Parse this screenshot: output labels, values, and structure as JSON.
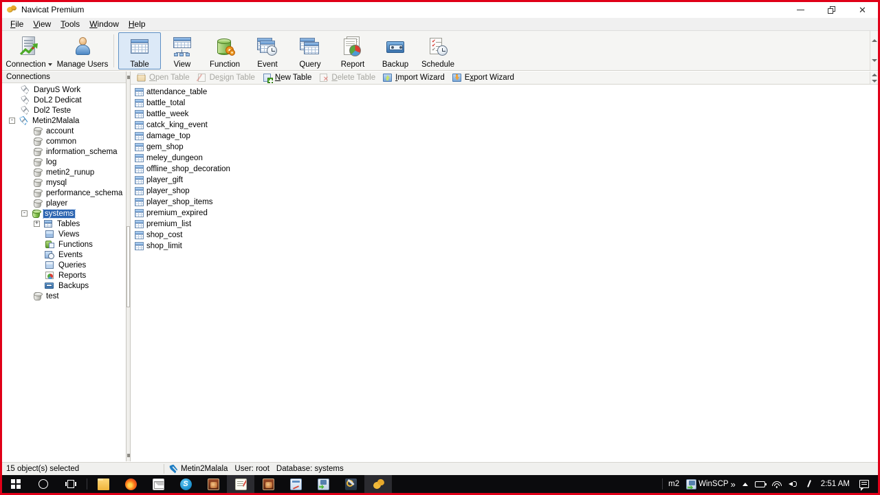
{
  "window": {
    "title": "Navicat Premium",
    "icon": "navicat-paw-icon",
    "controls": {
      "minimize": "minimize",
      "restore": "restore",
      "close": "close"
    }
  },
  "menubar": {
    "items": [
      {
        "label": "File",
        "accel": "F"
      },
      {
        "label": "View",
        "accel": "V"
      },
      {
        "label": "Tools",
        "accel": "T"
      },
      {
        "label": "Window",
        "accel": "W"
      },
      {
        "label": "Help",
        "accel": "H"
      }
    ]
  },
  "toolbar": {
    "connection": {
      "label": "Connection",
      "icon": "connection-icon",
      "has_dropdown": true
    },
    "manage_users": {
      "label": "Manage Users",
      "icon": "manage-users-icon"
    },
    "objects": [
      {
        "label": "Table",
        "icon": "table-icon",
        "selected": true
      },
      {
        "label": "View",
        "icon": "view-icon",
        "selected": false
      },
      {
        "label": "Function",
        "icon": "function-icon",
        "selected": false
      },
      {
        "label": "Event",
        "icon": "event-icon",
        "selected": false
      },
      {
        "label": "Query",
        "icon": "query-icon",
        "selected": false
      },
      {
        "label": "Report",
        "icon": "report-icon",
        "selected": false
      },
      {
        "label": "Backup",
        "icon": "backup-icon",
        "selected": false
      },
      {
        "label": "Schedule",
        "icon": "schedule-icon",
        "selected": false
      }
    ]
  },
  "content_toolbar": {
    "buttons": [
      {
        "label": "Open Table",
        "accel": "O",
        "icon": "open-table-icon",
        "disabled": true
      },
      {
        "label": "Design Table",
        "accel": "s",
        "icon": "design-table-icon",
        "disabled": true
      },
      {
        "label": "New Table",
        "accel": "N",
        "icon": "new-table-icon",
        "disabled": false
      },
      {
        "label": "Delete Table",
        "accel": "D",
        "icon": "delete-table-icon",
        "disabled": true
      },
      {
        "label": "Import Wizard",
        "accel": "I",
        "icon": "import-wizard-icon",
        "disabled": false
      },
      {
        "label": "Export Wizard",
        "accel": "x",
        "icon": "export-wizard-icon",
        "disabled": false
      }
    ]
  },
  "sidebar": {
    "header": "Connections",
    "nodes": [
      {
        "label": "DaryuS Work",
        "icon": "connection-icon",
        "depth": 0,
        "expander": "",
        "connected": false
      },
      {
        "label": "DoL2 Dedicat",
        "icon": "connection-icon",
        "depth": 0,
        "expander": "",
        "connected": false
      },
      {
        "label": "Dol2 Teste",
        "icon": "connection-icon",
        "depth": 0,
        "expander": "",
        "connected": false
      },
      {
        "label": "Metin2Malala",
        "icon": "connection-icon",
        "depth": 0,
        "expander": "-",
        "connected": true
      },
      {
        "label": "account",
        "icon": "database-icon",
        "depth": 1,
        "expander": "",
        "open": false
      },
      {
        "label": "common",
        "icon": "database-icon",
        "depth": 1,
        "expander": "",
        "open": false
      },
      {
        "label": "information_schema",
        "icon": "database-icon",
        "depth": 1,
        "expander": "",
        "open": false
      },
      {
        "label": "log",
        "icon": "database-icon",
        "depth": 1,
        "expander": "",
        "open": false
      },
      {
        "label": "metin2_runup",
        "icon": "database-icon",
        "depth": 1,
        "expander": "",
        "open": false
      },
      {
        "label": "mysql",
        "icon": "database-icon",
        "depth": 1,
        "expander": "",
        "open": false
      },
      {
        "label": "performance_schema",
        "icon": "database-icon",
        "depth": 1,
        "expander": "",
        "open": false
      },
      {
        "label": "player",
        "icon": "database-icon",
        "depth": 1,
        "expander": "",
        "open": false
      },
      {
        "label": "systems",
        "icon": "database-open-icon",
        "depth": 1,
        "expander": "-",
        "open": true,
        "selected": true
      },
      {
        "label": "Tables",
        "icon": "tables-folder-icon",
        "depth": 2,
        "expander": "+"
      },
      {
        "label": "Views",
        "icon": "views-folder-icon",
        "depth": 2,
        "expander": ""
      },
      {
        "label": "Functions",
        "icon": "functions-folder-icon",
        "depth": 2,
        "expander": ""
      },
      {
        "label": "Events",
        "icon": "events-folder-icon",
        "depth": 2,
        "expander": ""
      },
      {
        "label": "Queries",
        "icon": "queries-folder-icon",
        "depth": 2,
        "expander": ""
      },
      {
        "label": "Reports",
        "icon": "reports-folder-icon",
        "depth": 2,
        "expander": ""
      },
      {
        "label": "Backups",
        "icon": "backups-folder-icon",
        "depth": 2,
        "expander": ""
      },
      {
        "label": "test",
        "icon": "database-icon",
        "depth": 1,
        "expander": "",
        "open": false
      }
    ]
  },
  "object_list": {
    "items": [
      {
        "name": "attendance_table",
        "icon": "table-item-icon"
      },
      {
        "name": "battle_total",
        "icon": "table-item-icon"
      },
      {
        "name": "battle_week",
        "icon": "table-item-icon"
      },
      {
        "name": "catck_king_event",
        "icon": "table-item-icon"
      },
      {
        "name": "damage_top",
        "icon": "table-item-icon"
      },
      {
        "name": "gem_shop",
        "icon": "table-item-icon"
      },
      {
        "name": "meley_dungeon",
        "icon": "table-item-icon"
      },
      {
        "name": "offline_shop_decoration",
        "icon": "table-item-icon"
      },
      {
        "name": "player_gift",
        "icon": "table-item-icon"
      },
      {
        "name": "player_shop",
        "icon": "table-item-icon"
      },
      {
        "name": "player_shop_items",
        "icon": "table-item-icon"
      },
      {
        "name": "premium_expired",
        "icon": "table-item-icon"
      },
      {
        "name": "premium_list",
        "icon": "table-item-icon"
      },
      {
        "name": "shop_cost",
        "icon": "table-item-icon"
      },
      {
        "name": "shop_limit",
        "icon": "table-item-icon"
      }
    ]
  },
  "statusbar": {
    "selection": "15 object(s) selected",
    "connection": "Metin2Malala",
    "user": "User: root",
    "database": "Database: systems"
  },
  "taskbar": {
    "buttons": [
      {
        "name": "start-button",
        "icon": "windows-logo-icon"
      },
      {
        "name": "cortana-button",
        "icon": "circle-search-icon"
      },
      {
        "name": "task-view-button",
        "icon": "task-view-icon"
      },
      {
        "name": "file-explorer",
        "icon": "folder-icon"
      },
      {
        "name": "firefox",
        "icon": "firefox-icon"
      },
      {
        "name": "mail",
        "icon": "mail-icon"
      },
      {
        "name": "skype",
        "icon": "skype-icon"
      },
      {
        "name": "game-client-1",
        "icon": "picture-icon"
      },
      {
        "name": "notepad",
        "icon": "notepad-icon"
      },
      {
        "name": "game-client-2",
        "icon": "picture-icon"
      },
      {
        "name": "editor",
        "icon": "blue-doc-icon"
      },
      {
        "name": "winscp",
        "icon": "winscp-icon"
      },
      {
        "name": "tool",
        "icon": "wrench-icon"
      },
      {
        "name": "navicat",
        "icon": "navicat-paw-icon"
      }
    ],
    "tray": {
      "label_m2": "m2",
      "winscp_label": "WinSCP",
      "overflow": "»",
      "clock": "2:51 AM",
      "icons": [
        "chevron-up-icon",
        "battery-icon",
        "wifi-icon",
        "volume-icon",
        "pen-icon"
      ],
      "action_center": "action-center-icon"
    }
  },
  "colors": {
    "accent_border": "#e00018",
    "selection_blue": "#2a63b0",
    "toolbar_bg": "#f5f5f3",
    "taskbar_bg": "#0b0b0d"
  }
}
